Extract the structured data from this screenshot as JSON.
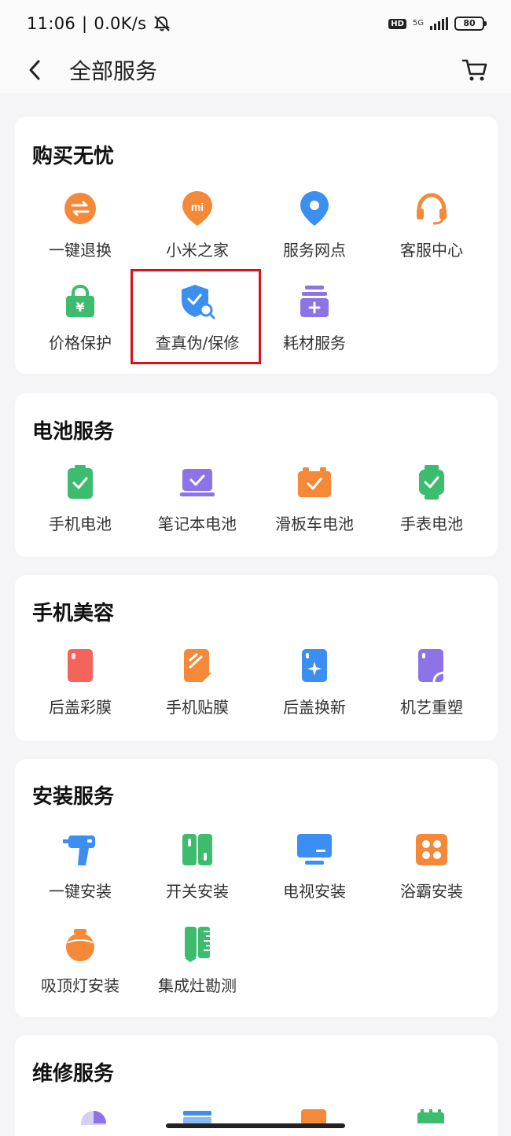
{
  "status": {
    "time": "11:06",
    "speed": "0.0K/s",
    "network": "5G",
    "battery": "80"
  },
  "header": {
    "title": "全部服务"
  },
  "sections": {
    "s1": {
      "title": "购买无忧",
      "items": [
        "一键退换",
        "小米之家",
        "服务网点",
        "客服中心",
        "价格保护",
        "查真伪/保修",
        "耗材服务"
      ]
    },
    "s2": {
      "title": "电池服务",
      "items": [
        "手机电池",
        "笔记本电池",
        "滑板车电池",
        "手表电池"
      ]
    },
    "s3": {
      "title": "手机美容",
      "items": [
        "后盖彩膜",
        "手机贴膜",
        "后盖换新",
        "机艺重塑"
      ]
    },
    "s4": {
      "title": "安装服务",
      "items": [
        "一键安装",
        "开关安装",
        "电视安装",
        "浴霸安装",
        "吸顶灯安装",
        "集成灶勘测"
      ]
    },
    "s5": {
      "title": "维修服务"
    }
  },
  "colors": {
    "orange": "#f5893a",
    "blue": "#3b8ff0",
    "green": "#3dbb6e",
    "purple": "#8c74e6",
    "red": "#f4645a",
    "highlight": "#d8111b"
  }
}
